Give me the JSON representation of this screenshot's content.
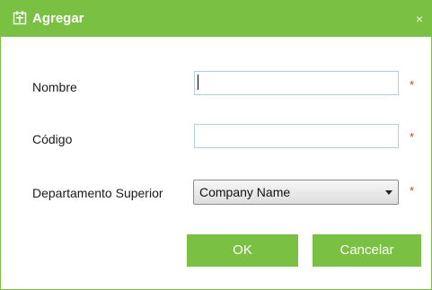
{
  "dialog": {
    "title": "Agregar",
    "close_label": "×"
  },
  "form": {
    "name_label": "Nombre",
    "name_value": "",
    "code_label": "Código",
    "code_value": "",
    "parent_label": "Departamento Superior",
    "parent_selected": "Company Name",
    "required_marker": "*"
  },
  "buttons": {
    "ok_label": "OK",
    "cancel_label": "Cancelar"
  },
  "colors": {
    "accent": "#7ac143",
    "required": "#e8392c"
  }
}
